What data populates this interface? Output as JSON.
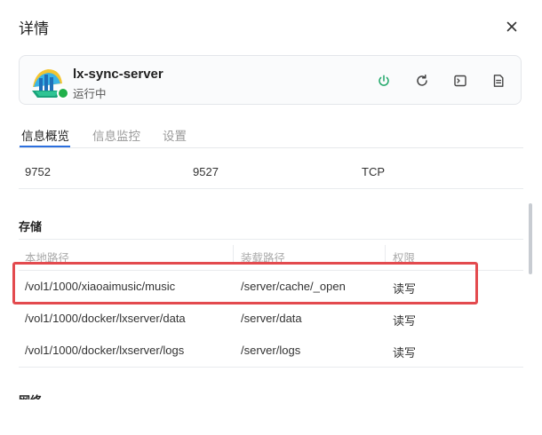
{
  "dialog": {
    "title": "详情"
  },
  "app": {
    "name": "lx-sync-server",
    "status": "运行中",
    "status_color": "#21b04b"
  },
  "toolbar": [
    "power-icon",
    "refresh-icon",
    "terminal-icon",
    "log-document-icon"
  ],
  "tabs": [
    {
      "label": "信息概览",
      "active": true
    },
    {
      "label": "信息监控",
      "active": false
    },
    {
      "label": "设置",
      "active": false
    }
  ],
  "ports": {
    "host": "9752",
    "container": "9527",
    "protocol": "TCP"
  },
  "storage": {
    "title": "存储",
    "columns": [
      "本地路径",
      "装载路径",
      "权限"
    ],
    "rows": [
      {
        "local": "/vol1/1000/xiaoaimusic/music",
        "mount": "/server/cache/_open",
        "perm": "读写"
      },
      {
        "local": "/vol1/1000/docker/lxserver/data",
        "mount": "/server/data",
        "perm": "读写"
      },
      {
        "local": "/vol1/1000/docker/lxserver/logs",
        "mount": "/server/logs",
        "perm": "读写"
      }
    ]
  },
  "next_section": {
    "title": "网络"
  },
  "colors": {
    "accent": "#2c6fde",
    "highlight": "#e34a4e"
  }
}
